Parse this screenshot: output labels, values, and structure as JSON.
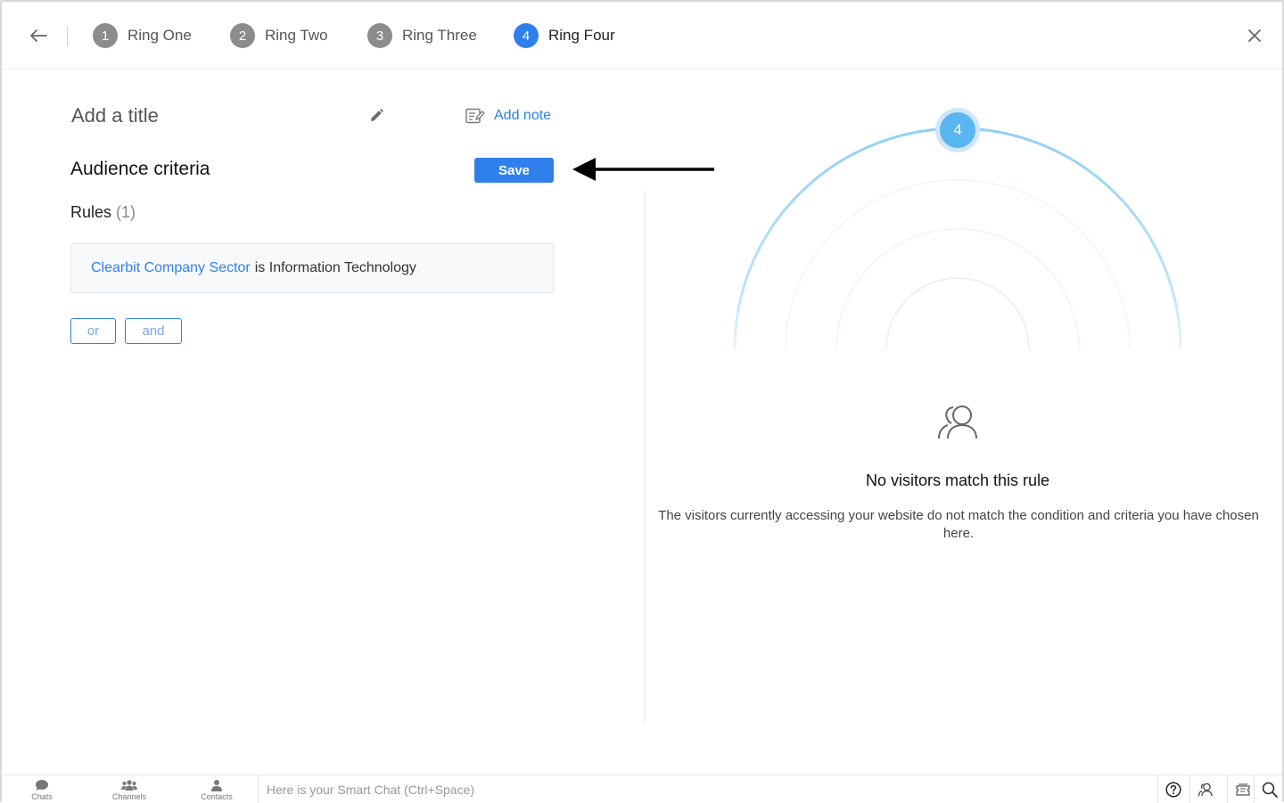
{
  "header": {
    "steps": [
      {
        "number": "1",
        "label": "Ring One"
      },
      {
        "number": "2",
        "label": "Ring Two"
      },
      {
        "number": "3",
        "label": "Ring Three"
      },
      {
        "number": "4",
        "label": "Ring Four",
        "active": true
      }
    ]
  },
  "editor": {
    "title_placeholder": "Add a title",
    "add_note_label": "Add note",
    "section_title": "Audience criteria",
    "save_label": "Save",
    "rules_label": "Rules",
    "rules_count": "(1)",
    "rules": [
      {
        "field": "Clearbit Company Sector",
        "condition": "is Information Technology"
      }
    ],
    "or_label": "or",
    "and_label": "and"
  },
  "preview": {
    "ring_number": "4",
    "empty_title": "No visitors match this rule",
    "empty_description": "The visitors currently accessing your website do not match the condition and criteria you have chosen here."
  },
  "bottom_bar": {
    "nav": [
      {
        "label": "Chats",
        "icon": "chat-bubble-icon"
      },
      {
        "label": "Channels",
        "icon": "people-group-icon"
      },
      {
        "label": "Contacts",
        "icon": "person-icon"
      }
    ],
    "smart_chat_placeholder": "Here is your Smart Chat (Ctrl+Space)",
    "tools": [
      "help-icon",
      "visitors-icon",
      "tickets-icon",
      "search-icon"
    ]
  },
  "colors": {
    "accent": "#2f80ed",
    "ring_blue": "#58b6f0",
    "inactive_step": "#8c8c8c"
  }
}
